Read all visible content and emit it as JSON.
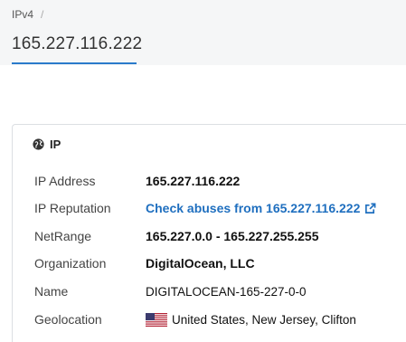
{
  "breadcrumb": {
    "item": "IPv4",
    "separator": "/"
  },
  "page_title": "165.227.116.222",
  "card": {
    "title": "IP",
    "rows": [
      {
        "label": "IP Address",
        "value": "165.227.116.222"
      },
      {
        "label": "IP Reputation",
        "value": "Check abuses from 165.227.116.222"
      },
      {
        "label": "NetRange",
        "value": "165.227.0.0 - 165.227.255.255"
      },
      {
        "label": "Organization",
        "value": "DigitalOcean, LLC"
      },
      {
        "label": "Name",
        "value": "DIGITALOCEAN-165-227-0-0"
      },
      {
        "label": "Geolocation",
        "value": "United States, New Jersey, Clifton"
      }
    ]
  },
  "colors": {
    "accent": "#2a7bcb",
    "link": "#1f6fbf",
    "header_bg": "#f5f6f7"
  },
  "icons": {
    "card": "globe-icon",
    "reputation": "external-link-icon",
    "geolocation": "us-flag-icon"
  }
}
